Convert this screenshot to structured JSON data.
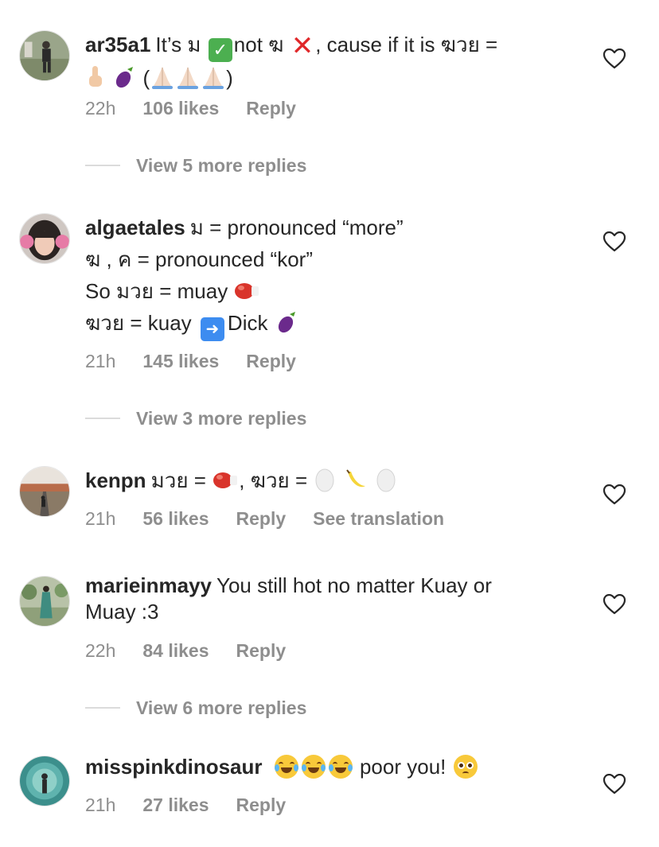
{
  "colors": {
    "text": "#262626",
    "muted": "#8e8e8e",
    "divider": "#dbdbdb",
    "background": "#ffffff"
  },
  "comments": [
    {
      "username": "ar35a1",
      "lines": [
        "It’s ม",
        "not ฆ",
        ", cause if it is ฆวย =",
        "(",
        ")"
      ],
      "time": "22h",
      "likes": "106 likes",
      "reply": "Reply",
      "view_replies": "View 5 more replies",
      "avatar_icon": "person-outdoor-avatar"
    },
    {
      "username": "algaetales",
      "lines": [
        "ม = pronounced “more”",
        "ฆ , ค = pronounced “kor”",
        "So มวย = muay",
        "ฆวย = kuay",
        "Dick"
      ],
      "time": "21h",
      "likes": "145 likes",
      "reply": "Reply",
      "view_replies": "View 3 more replies",
      "avatar_icon": "girl-pink-earmuffs-avatar"
    },
    {
      "username": "kenpn",
      "lines": [
        "มวย =",
        ", ฆวย ="
      ],
      "time": "21h",
      "likes": "56 likes",
      "reply": "Reply",
      "see_translation": "See translation",
      "avatar_icon": "road-landscape-avatar"
    },
    {
      "username": "marieinmayy",
      "lines": [
        "You still hot no matter Kuay or",
        "Muay :3"
      ],
      "time": "22h",
      "likes": "84 likes",
      "reply": "Reply",
      "view_replies": "View 6 more replies",
      "avatar_icon": "woman-garden-avatar"
    },
    {
      "username": "misspinkdinosaur",
      "lines": [
        "poor you!"
      ],
      "time": "21h",
      "likes": "27 likes",
      "reply": "Reply",
      "avatar_icon": "teal-circle-avatar"
    }
  ]
}
